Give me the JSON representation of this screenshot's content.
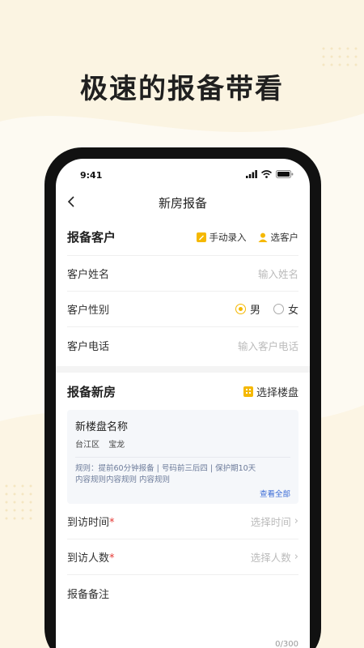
{
  "headline": "极速的报备带看",
  "statusbar": {
    "time": "9:41"
  },
  "nav": {
    "title": "新房报备"
  },
  "customer": {
    "section_title": "报备客户",
    "manual_entry": "手动录入",
    "select_customer": "选客户",
    "name_label": "客户姓名",
    "name_placeholder": "输入姓名",
    "gender_label": "客户性别",
    "gender_male": "男",
    "gender_female": "女",
    "gender_selected": "男",
    "phone_label": "客户电话",
    "phone_placeholder": "输入客户电话"
  },
  "property": {
    "section_title": "报备新房",
    "select_property": "选择楼盘",
    "card": {
      "name": "新楼盘名称",
      "district": "台江区",
      "area": "宝龙",
      "rule_line1": "规则：提前60分钟报备 | 号码前三后四 | 保护期10天",
      "rule_line2": "内容规则内容规则 内容规则",
      "view_all": "查看全部"
    },
    "visit_time_label": "到访时间",
    "visit_time_placeholder": "选择时间",
    "visit_count_label": "到访人数",
    "visit_count_placeholder": "选择人数",
    "remark_label": "报备备注",
    "remark_counter": "0/300",
    "required_mark": "*"
  },
  "colors": {
    "accent": "#f5b800",
    "link": "#3a6bd6",
    "required": "#e53935"
  }
}
